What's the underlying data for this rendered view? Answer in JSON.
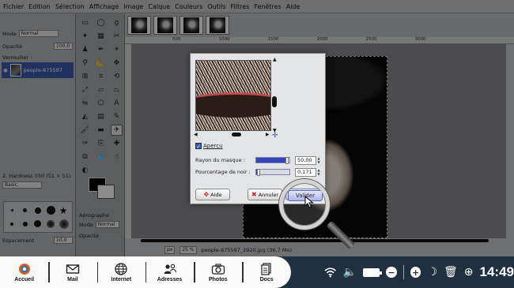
{
  "menubar": [
    "Fichier",
    "Edition",
    "Sélection",
    "Affichage",
    "Image",
    "Calque",
    "Couleurs",
    "Outils",
    "Filtres",
    "Fenêtres",
    "Aide"
  ],
  "layers": {
    "mode_label": "Mode",
    "mode_value": "Normal",
    "opacity_label": "Opacité",
    "opacity_value": "100,0",
    "lock_label": "Verrouiller :",
    "layer_name": "people-875597"
  },
  "brushes": {
    "preset_label": "2. Hardness 050 (51 × 51)",
    "category": "Basic,",
    "spacing_label": "Espacement",
    "spacing_value": "10,0"
  },
  "tool_options": {
    "title": "Aérographe",
    "mode_label": "Mode",
    "mode_value": "Normal",
    "opacity_label": "Opacité"
  },
  "statusbar": {
    "unit": "px",
    "zoom": "25 %",
    "filename": "people-875597_1920.jpg (36,7 Mo)"
  },
  "ruler_ticks": [
    "500",
    "1000",
    "1500",
    "2000",
    "2500",
    "3000"
  ],
  "dialog": {
    "preview_label": "Aperçu",
    "preview_checked": true,
    "radius_label": "Rayon du masque :",
    "radius_value": "50,00",
    "radius_level": 0.95,
    "black_label": "Pourcentage de noir :",
    "black_value": "0,171",
    "black_level": 0.1,
    "help_label": "Aide",
    "cancel_label": "Annuler",
    "ok_label": "Valider"
  },
  "taskbar": {
    "apps": [
      {
        "label": "Accueil",
        "icon": "home-logo-icon"
      },
      {
        "label": "Mail",
        "icon": "envelope-icon"
      },
      {
        "label": "Internet",
        "icon": "globe-icon"
      },
      {
        "label": "Adresses",
        "icon": "contacts-icon"
      },
      {
        "label": "Photos",
        "icon": "camera-icon"
      },
      {
        "label": "Docs",
        "icon": "documents-icon"
      }
    ],
    "clock": "14:49"
  },
  "colors": {
    "taskbar_bg": "#1f3040",
    "selection_blue": "#3d5bb0",
    "accent_orange": "#e05a1a"
  }
}
